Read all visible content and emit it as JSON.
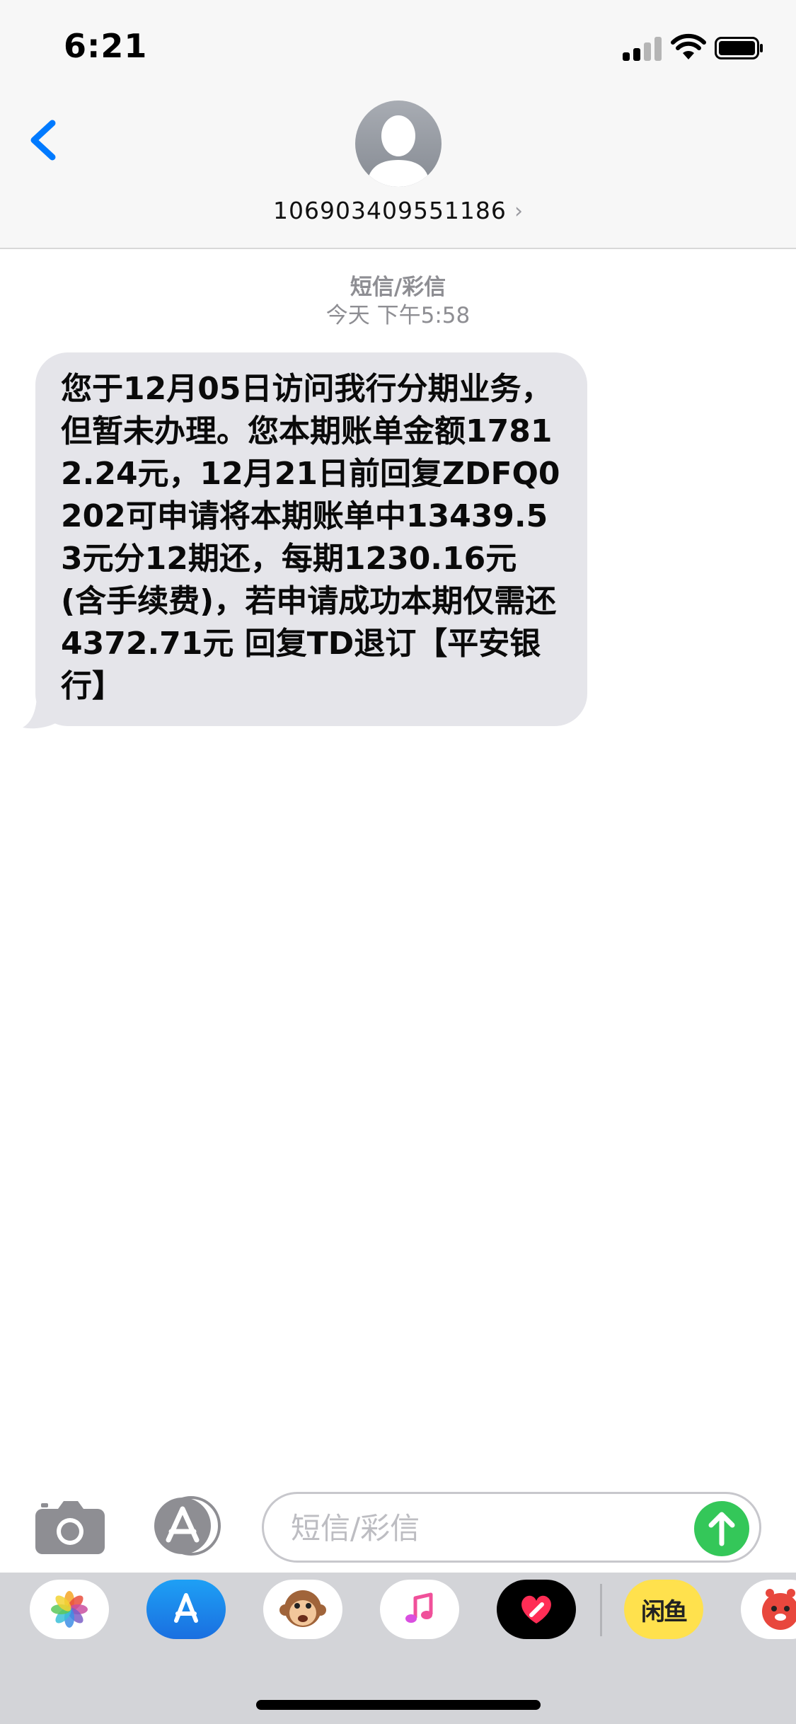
{
  "status_bar": {
    "time": "6:21"
  },
  "header": {
    "contact_name": "106903409551186",
    "chevron": "›"
  },
  "thread": {
    "message_type": "短信/彩信",
    "timestamp": "今天 下午5:58"
  },
  "messages": [
    {
      "direction": "incoming",
      "text": "您于12月05日访问我行分期业务，但暂未办理。您本期账单金额17812.24元，12月21日前回复ZDFQ0202可申请将本期账单中13439.53元分12期还，每期1230.16元(含手续费)，若申请成功本期仅需还4372.71元 回复TD退订【平安银行】"
    }
  ],
  "input_bar": {
    "placeholder": "短信/彩信"
  },
  "app_drawer": {
    "apps": [
      {
        "name": "photos-app-icon"
      },
      {
        "name": "app-store-app-icon"
      },
      {
        "name": "animoji-app-icon"
      },
      {
        "name": "music-app-icon"
      },
      {
        "name": "digital-touch-app-icon"
      },
      {
        "name": "xianyu-app-icon",
        "label": "闲鱼"
      },
      {
        "name": "sticker-app-icon"
      }
    ]
  },
  "colors": {
    "accent_blue": "#007aff",
    "send_green": "#34c759",
    "bubble_gray": "#e5e5ea"
  }
}
